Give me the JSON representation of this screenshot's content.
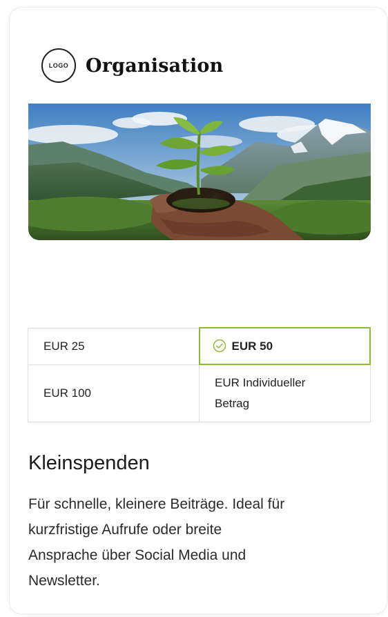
{
  "header": {
    "logo_text": "LOGO",
    "org_name": "Organisation"
  },
  "hero": {
    "image_name": "hands-holding-seedling-mountains"
  },
  "amounts": {
    "option_25": "EUR 25",
    "option_50": "EUR 50",
    "option_100": "EUR 100",
    "option_custom_line1": "EUR Individueller",
    "option_custom_line2": "Betrag",
    "selected": "EUR 50",
    "selected_color": "#8fb83a"
  },
  "content": {
    "title": "Kleinspenden",
    "desc_line1": "Für schnelle, kleinere Beiträge. Ideal für",
    "desc_line2": "kurzfristige Aufrufe oder breite",
    "desc_line3": "Ansprache über Social Media und",
    "desc_line4": "Newsletter."
  }
}
